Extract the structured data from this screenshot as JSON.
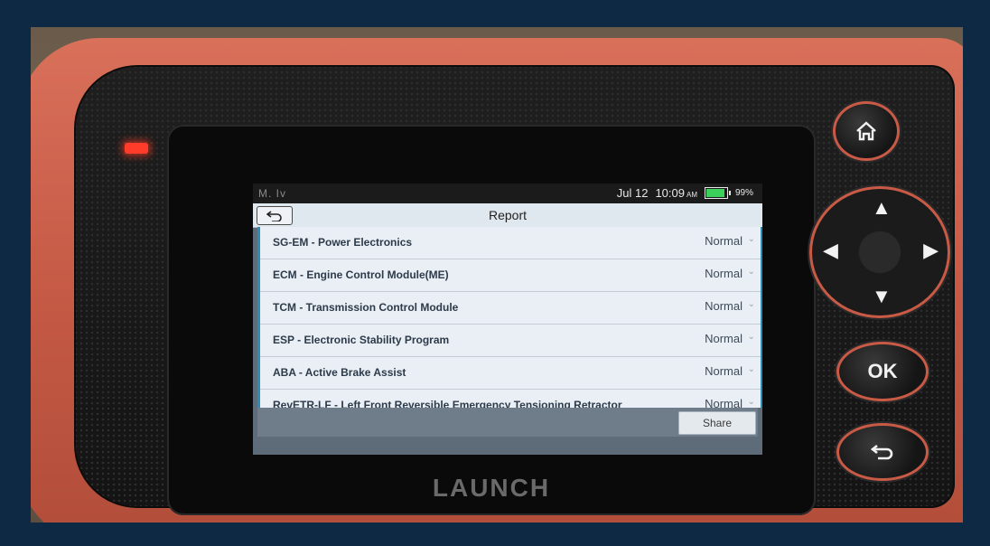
{
  "status_bar": {
    "left_indicators": "M. Iv",
    "date": "Jul 12",
    "time": "10:09",
    "ampm": "AM",
    "battery_percent": "99%",
    "battery_level": 0.99,
    "battery_color": "#3bd15a"
  },
  "header": {
    "back_icon": "return-arrow-icon",
    "title": "Report"
  },
  "report": {
    "rows": [
      {
        "name": "SG-EM - Power Electronics",
        "status": "Normal"
      },
      {
        "name": "ECM - Engine Control Module(ME)",
        "status": "Normal"
      },
      {
        "name": "TCM - Transmission Control Module",
        "status": "Normal"
      },
      {
        "name": "ESP - Electronic Stability Program",
        "status": "Normal"
      },
      {
        "name": "ABA - Active Brake Assist",
        "status": "Normal"
      },
      {
        "name": "RevETR-LF - Left Front Reversible Emergency Tensioning Retractor",
        "status": "Normal"
      }
    ]
  },
  "footer": {
    "share_label": "Share"
  },
  "device": {
    "brand": "LAUNCH",
    "ok_label": "OK",
    "accent_color": "#c85a46"
  }
}
